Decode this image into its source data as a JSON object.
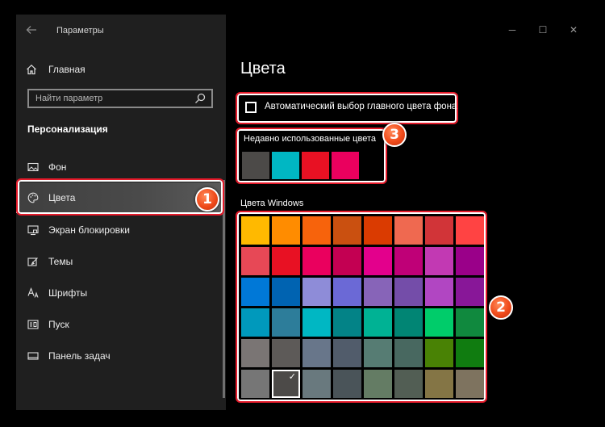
{
  "window": {
    "title": "Параметры",
    "back_icon": "arrow-left-icon",
    "controls": [
      "minimize-icon",
      "maximize-icon",
      "close-icon"
    ]
  },
  "sidebar": {
    "home_label": "Главная",
    "search_placeholder": "Найти параметр",
    "section_title": "Персонализация",
    "items": [
      {
        "label": "Фон",
        "icon": "image-icon",
        "active": false
      },
      {
        "label": "Цвета",
        "icon": "palette-icon",
        "active": true
      },
      {
        "label": "Экран блокировки",
        "icon": "lock-screen-icon",
        "active": false
      },
      {
        "label": "Темы",
        "icon": "themes-icon",
        "active": false
      },
      {
        "label": "Шрифты",
        "icon": "fonts-icon",
        "active": false
      },
      {
        "label": "Пуск",
        "icon": "start-icon",
        "active": false
      },
      {
        "label": "Панель задач",
        "icon": "taskbar-icon",
        "active": false
      }
    ]
  },
  "main": {
    "title": "Цвета",
    "auto_accent_label": "Автоматический выбор главного цвета фона",
    "auto_accent_checked": false,
    "recent_label": "Недавно использованные цвета",
    "recent_colors": [
      "#4c4a48",
      "#00b7c3",
      "#e81123",
      "#ea005e"
    ],
    "windows_colors_label": "Цвета Windows",
    "windows_colors": [
      [
        "#ffb900",
        "#ff8c00",
        "#f7630c",
        "#ca5010",
        "#da3b01",
        "#ef6950",
        "#d13438",
        "#ff4343"
      ],
      [
        "#e74856",
        "#e81123",
        "#ea005e",
        "#c30052",
        "#e3008c",
        "#bf0077",
        "#c239b3",
        "#9a0089"
      ],
      [
        "#0078d7",
        "#0063b1",
        "#8e8cd8",
        "#6b69d6",
        "#8764b8",
        "#744da9",
        "#b146c2",
        "#881798"
      ],
      [
        "#0099bc",
        "#2d7d9a",
        "#00b7c3",
        "#038387",
        "#00b294",
        "#018574",
        "#00cc6a",
        "#10893e"
      ],
      [
        "#7a7574",
        "#5d5a58",
        "#68768a",
        "#515c6b",
        "#567c73",
        "#486860",
        "#498205",
        "#107c10"
      ],
      [
        "#767676",
        "#4c4a48",
        "#69797e",
        "#4a5459",
        "#647c64",
        "#525e54",
        "#847545",
        "#7e735f"
      ]
    ],
    "selected_color": {
      "row": 5,
      "col": 1
    }
  },
  "annotations": [
    {
      "number": "1"
    },
    {
      "number": "2"
    },
    {
      "number": "3"
    }
  ],
  "colors": {
    "sidebar_bg": "#1f1f1f",
    "highlight_frame": "#e51a2a",
    "badge": "#f04a1a"
  }
}
